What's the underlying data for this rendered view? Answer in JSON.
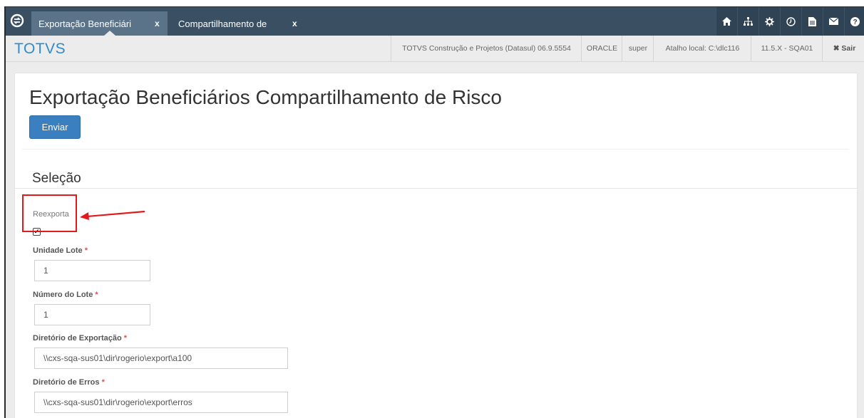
{
  "tabs": [
    {
      "label": "Exportação Beneficiári",
      "close": "x",
      "active": true
    },
    {
      "label": "Compartilhamento de",
      "close": "x",
      "active": false
    }
  ],
  "icons": [
    "logo-icon",
    "home-icon",
    "sitemap-icon",
    "gear-icon",
    "clock-icon",
    "document-icon",
    "mail-icon",
    "help-icon"
  ],
  "header": {
    "brand": "TOTVS",
    "product": "TOTVS Construção e Projetos (Datasul) 06.9.5554",
    "database": "ORACLE",
    "user": "super",
    "shortcut": "Atalho local: C:\\dlc116",
    "version": "11.5.X - SQA01",
    "logout": "✖ Sair"
  },
  "page": {
    "title": "Exportação Beneficiários Compartilhamento de Risco",
    "send_button": "Enviar",
    "section_title": "Seleção"
  },
  "form": {
    "reexporta_label": "Reexporta",
    "reexporta_checked": true,
    "unidade_lote_label": "Unidade Lote",
    "unidade_lote_value": "1",
    "numero_lote_label": "Número do Lote",
    "numero_lote_value": "1",
    "dir_export_label": "Diretório de Exportação",
    "dir_export_value": "\\\\cxs-sqa-sus01\\dir\\rogerio\\export\\a100",
    "dir_erros_label": "Diretório de Erros",
    "dir_erros_value": "\\\\cxs-sqa-sus01\\dir\\rogerio\\export\\erros",
    "required_mark": "*"
  },
  "colors": {
    "topbar": "#3a4f61",
    "active_tab": "#5b7388",
    "brand": "#2e8bcc",
    "primary_button": "#3a7fc0",
    "annotation": "#e11b1b"
  }
}
